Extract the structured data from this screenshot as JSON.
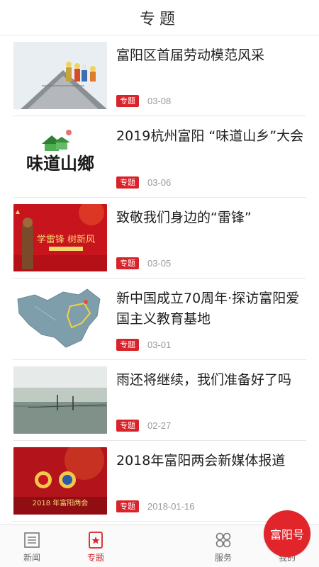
{
  "header": {
    "title": "专题"
  },
  "items": [
    {
      "title": "富阳区首届劳动模范风采",
      "tag": "专题",
      "date": "03-08"
    },
    {
      "title": "2019杭州富阳 “味道山乡”大会",
      "tag": "专题",
      "date": "03-06"
    },
    {
      "title": "致敬我们身边的“雷锋”",
      "tag": "专题",
      "date": "03-05"
    },
    {
      "title": "新中国成立70周年·探访富阳爱国主义教育基地",
      "tag": "专题",
      "date": "03-01"
    },
    {
      "title": "雨还将继续，我们准备好了吗",
      "tag": "专题",
      "date": "02-27"
    },
    {
      "title": "2018年富阳两会新媒体报道",
      "tag": "专题",
      "date": "2018-01-16"
    }
  ],
  "thumb_text": {
    "weidao": "味道山鄉",
    "leifeng": "学雷锋 树新风",
    "lianghui": "2018 年富阳两会"
  },
  "tabbar": {
    "news": "新闻",
    "topic": "专题",
    "center": "富阳号",
    "service": "服务",
    "mine": "我的"
  },
  "colors": {
    "accent": "#d9232a"
  }
}
